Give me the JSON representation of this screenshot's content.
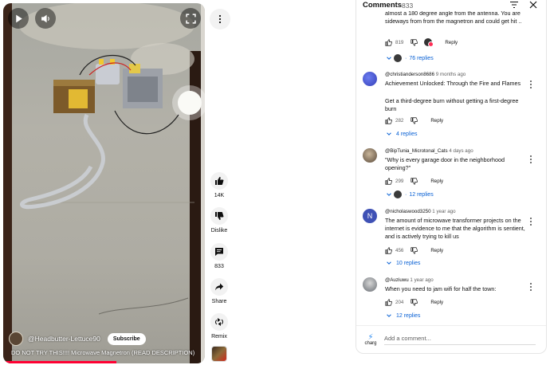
{
  "video": {
    "channel_handle": "@Headbutter-Lettuce90",
    "subscribe_label": "Subscribe",
    "title": "DO NOT TRY THIS!!!! Microwave Magnetron (READ DESCRIPTION)",
    "progress": 0.56
  },
  "actions": {
    "like_count": "14K",
    "dislike_label": "Dislike",
    "comment_count": "833",
    "share_label": "Share",
    "remix_label": "Remix"
  },
  "comments_panel": {
    "title": "Comments",
    "count": "833",
    "add_placeholder": "Add a comment...",
    "user_label": "charg",
    "colors": {
      "link": "#065fd4",
      "meta": "#606060"
    },
    "items": [
      {
        "handle": "",
        "age": "",
        "text": "almost a 180 degree angle from the antenna. You are sideways from from the magnetron and could get hit ..",
        "likes": "819",
        "reply_label": "Reply",
        "replies": "76 replies",
        "creator_heart": true
      },
      {
        "handle": "@christianderson8686",
        "age": "9 months ago",
        "text": "Achievement Unlocked: Through the Fire and Flames",
        "text2": "Get a third-degree burn without getting a first-degree burn",
        "likes": "282",
        "reply_label": "Reply",
        "replies": "4 replies"
      },
      {
        "handle": "@BipTunia_Microtonal_Cats",
        "age": "4 days ago",
        "text": "\"Why is every garage door in the neighborhood opening?\"",
        "likes": "299",
        "reply_label": "Reply",
        "replies": "12 replies"
      },
      {
        "handle": "@nicholaswood3250",
        "age": "1 year ago",
        "avatar_letter": "N",
        "text": "The amount of microwave transformer projects on the internet is evidence to me that the algorithm is sentient, and is actively trying to kill us",
        "likes": "456",
        "reply_label": "Reply",
        "replies": "10 replies"
      },
      {
        "handle": "@Auziuwu",
        "age": "1 year ago",
        "text": "When you need to jam wifi for half the town:",
        "likes": "204",
        "reply_label": "Reply",
        "replies": "12 replies"
      }
    ]
  },
  "icons": [
    "play-icon",
    "volume-icon",
    "fullscreen-icon",
    "more-vert-icon",
    "thumb-up-icon",
    "thumb-down-icon",
    "comment-icon",
    "share-icon",
    "remix-icon",
    "sort-icon",
    "close-icon",
    "chevron-down-icon"
  ]
}
